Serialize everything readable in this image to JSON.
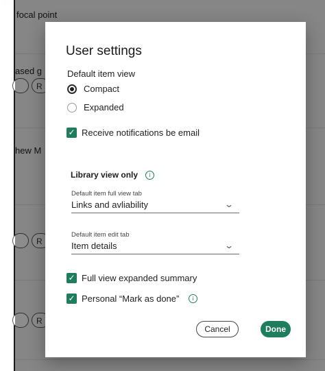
{
  "background": {
    "header_text": "focal point",
    "row1_text": "ased g",
    "row2_text": "hew M",
    "chip_letter": "R"
  },
  "dialog": {
    "title": "User settings",
    "default_view": {
      "label": "Default item view",
      "options": [
        {
          "label": "Compact",
          "selected": true
        },
        {
          "label": "Expanded",
          "selected": false
        }
      ]
    },
    "email_notifications": {
      "label": "Receive notifications be email",
      "checked": true
    },
    "library": {
      "title": "Library view only",
      "full_view_tab": {
        "label": "Default item full view tab",
        "value": "Links and avliability"
      },
      "edit_tab": {
        "label": "Default item edit tab",
        "value": "Item details"
      },
      "expanded_summary": {
        "label": "Full view expanded summary",
        "checked": true
      },
      "mark_as_done": {
        "label": "Personal “Mark as done”",
        "checked": true
      }
    },
    "buttons": {
      "cancel": "Cancel",
      "done": "Done"
    }
  },
  "colors": {
    "accent": "#1e7d5d"
  }
}
